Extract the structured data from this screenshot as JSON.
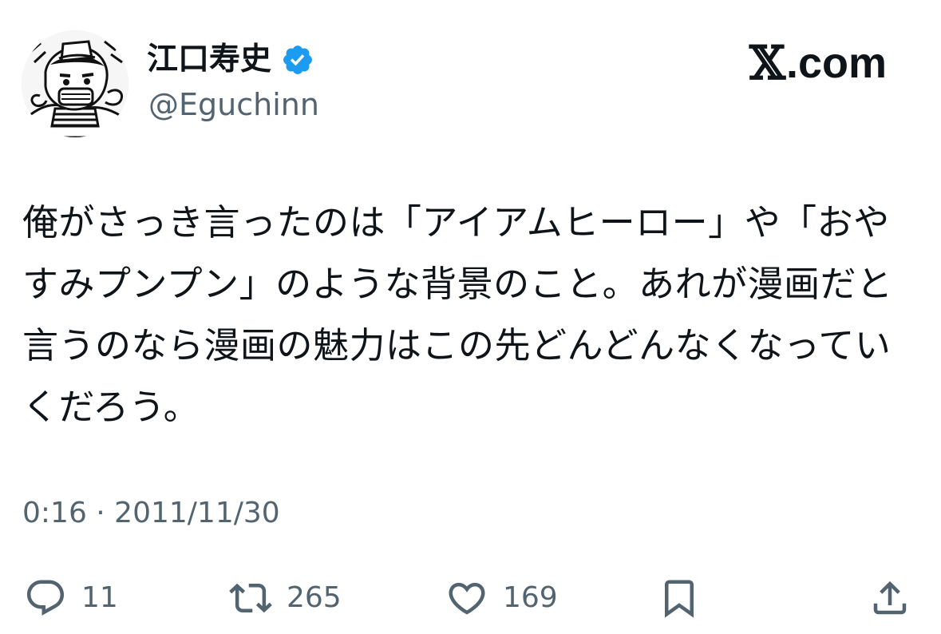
{
  "user": {
    "display_name": "江口寿史",
    "handle": "@Eguchinn",
    "verified": true,
    "avatar_icon": "manga-avatar-illustration"
  },
  "brand": {
    "logo_glyph": "𝕏",
    "suffix": ".com"
  },
  "tweet": {
    "text": "俺がさっき言ったのは「アイアムヒーロー」や「おやすみプンプン」のような背景のこと。あれが漫画だと言うのなら漫画の魅力はこの先どんどんなくなっていくだろう。",
    "timestamp": "0:16 · 2011/11/30"
  },
  "actions": {
    "reply": {
      "icon": "reply-icon",
      "count": "11"
    },
    "repost": {
      "icon": "repost-icon",
      "count": "265"
    },
    "like": {
      "icon": "heart-icon",
      "count": "169"
    },
    "bookmark": {
      "icon": "bookmark-icon"
    },
    "share": {
      "icon": "share-icon"
    }
  },
  "colors": {
    "text": "#0f1419",
    "secondary": "#536471",
    "verified": "#1d9bf0"
  }
}
